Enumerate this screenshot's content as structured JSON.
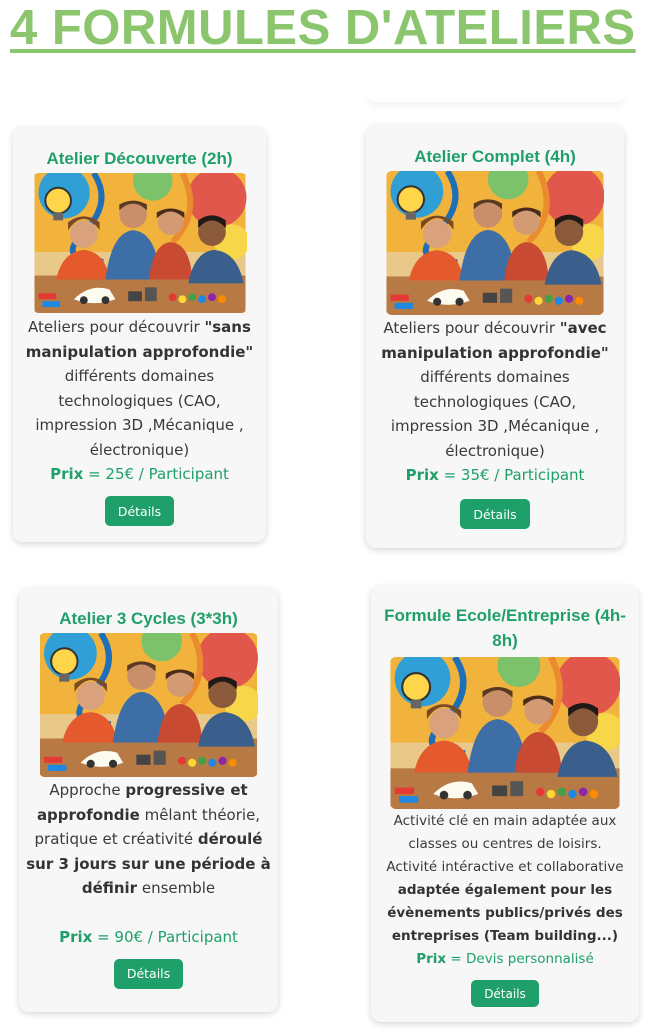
{
  "page": {
    "title": "4 FORMULES D'ATELIERS"
  },
  "colors": {
    "accent_green": "#1fa06a",
    "title_green": "#8bc56e",
    "card_bg": "#f7f7f7"
  },
  "cards": [
    {
      "title": "Atelier Découverte (2h)",
      "image_icon": "workshop-photo",
      "desc": {
        "l1_pre": "Ateliers pour découvrir ",
        "l1_bold": "\"sans",
        "l2_bold": "manipulation approfondie\"",
        "l3": "différents domaines",
        "l4": "technologiques (CAO,",
        "l5": "impression 3D ,Mécanique ,",
        "l6": "électronique)"
      },
      "price_label": "Prix",
      "price_value": " = 25€ / Participant",
      "button": "Détails"
    },
    {
      "title": "Atelier Complet (4h)",
      "image_icon": "workshop-photo",
      "desc": {
        "l1_pre": "Ateliers pour découvrir ",
        "l1_bold": "\"avec",
        "l2_bold": "manipulation approfondie\"",
        "l3": "différents domaines",
        "l4": "technologiques (CAO,",
        "l5": "impression 3D ,Mécanique ,",
        "l6": "électronique)"
      },
      "price_label": "Prix",
      "price_value": " = 35€ / Participant",
      "button": "Détails"
    },
    {
      "title": "Atelier 3 Cycles (3*3h)",
      "image_icon": "workshop-photo",
      "desc": {
        "l1_pre": "Approche ",
        "l1_bold": "progressive et",
        "l2_bold": "approfondie",
        "l2_rest": " mêlant théorie,",
        "l3_pre": "pratique et créativité ",
        "l3_bold": "déroulé",
        "l4_bold": "sur 3 jours sur une période à",
        "l5_bold": "définir",
        "l5_rest": " ensemble"
      },
      "price_label": "Prix",
      "price_value": " = 90€ / Participant",
      "button": "Détails"
    },
    {
      "title_l1": "Formule Ecole/Entreprise (4h-",
      "title_l2": "8h)",
      "image_icon": "workshop-photo",
      "desc": {
        "l1": "Activité clé en main adaptée aux",
        "l2": "classes ou centres de loisirs.",
        "l3": "Activité intéractive et collaborative",
        "l4_bold": "adaptée également pour les",
        "l5_bold": "évènements publics/privés des",
        "l6_bold": "entreprises (Team building...)"
      },
      "price_label": "Prix",
      "price_value": " = Devis personnalisé",
      "button": "Détails"
    }
  ]
}
